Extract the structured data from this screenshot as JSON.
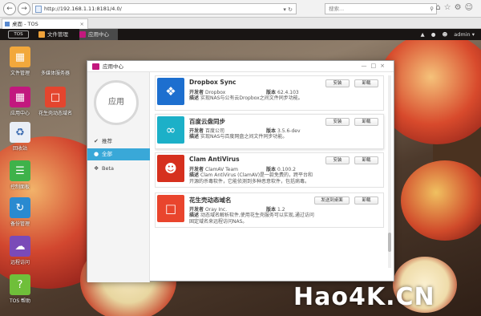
{
  "browser": {
    "address": "http://192.168.1.11:8181/4.0/",
    "search_placeholder": "搜索...",
    "tab_title": "桌面 - TOS"
  },
  "taskbar": {
    "logo": "TOS",
    "tasks": [
      "文件管理",
      "应用中心"
    ],
    "user": "admin"
  },
  "desktop_icons": [
    {
      "label": "文件管理"
    },
    {
      "label": "多媒体服务器"
    },
    {
      "label": "应用中心"
    },
    {
      "label": "花生壳动态域名"
    },
    {
      "label": "回收站"
    },
    {
      "label": "控制面板"
    },
    {
      "label": "备份管理"
    },
    {
      "label": "远程访问"
    },
    {
      "label": "TOS 帮助"
    }
  ],
  "window": {
    "title": "应用中心",
    "side_circle": "应用",
    "nav": [
      "推荐",
      "全部",
      "Beta"
    ],
    "apps": [
      {
        "name": "Dropbox Sync",
        "dev_label": "开发者",
        "dev": "Dropbox",
        "ver_label": "版本",
        "ver": "62.4.103",
        "desc_label": "描述",
        "desc": "实现NAS与公有云Dropbox之间文件同步功能。",
        "buttons": [
          "安装",
          "卸载"
        ]
      },
      {
        "name": "百度云盘同步",
        "dev_label": "开发者",
        "dev": "百度公司",
        "ver_label": "版本",
        "ver": "3.5.6-dev",
        "desc_label": "描述",
        "desc": "实现NAS与百度网盘之间文件同步功能。",
        "buttons": [
          "安装",
          "卸载"
        ]
      },
      {
        "name": "Clam AntiVirus",
        "dev_label": "开发者",
        "dev": "ClamAV Team",
        "ver_label": "版本",
        "ver": "0.100.2",
        "desc_label": "描述",
        "desc": "Clam AntiVirus (ClamAV)是一款免费的，跨平台和开源的杀毒软件，它能侦测到多种恶意软件，包括病毒。",
        "buttons": [
          "安装",
          "卸载"
        ]
      },
      {
        "name": "花生壳动态域名",
        "dev_label": "开发者",
        "dev": "Oray Inc.",
        "ver_label": "版本",
        "ver": "1.2",
        "desc_label": "描述",
        "desc": "动态域名解析软件,使用花生壳服务可以实现,通过访问固定域名来远程访问NAS。",
        "buttons": [
          "发送到桌面",
          "卸载"
        ]
      }
    ]
  },
  "watermark": "Hao4K.CN"
}
